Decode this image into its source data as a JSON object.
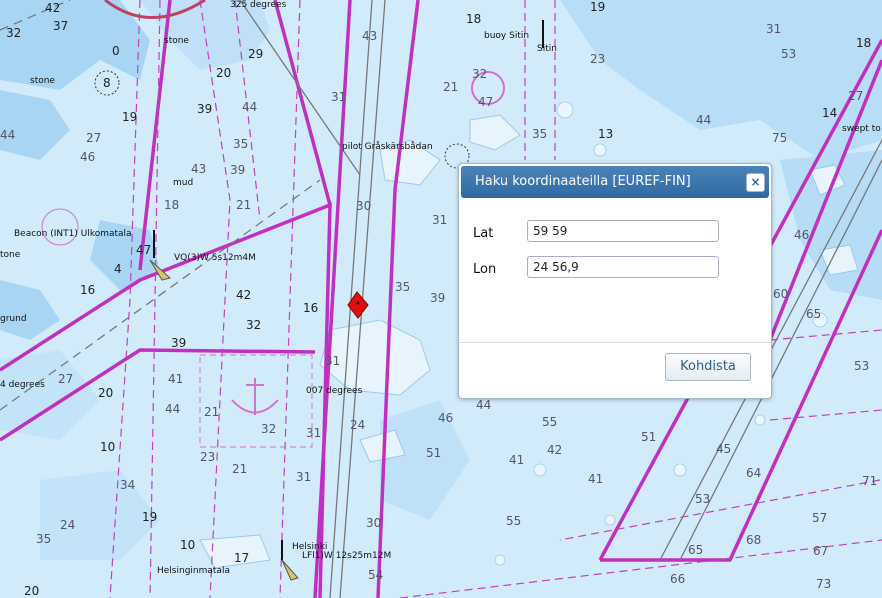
{
  "dialog": {
    "title": "Haku koordinaateilla [EUREF-FIN]",
    "close_label": "×",
    "lat_label": "Lat",
    "lat_value": "59 59",
    "lon_label": "Lon",
    "lon_value": "24 56,9",
    "submit_label": "Kohdista"
  },
  "map": {
    "labels": {
      "bearing_325": "325 degrees",
      "bearing_007": "007 degrees",
      "bearing_left": "4 degrees",
      "stone_top": "stone",
      "stone_left": "stone",
      "stone_far_left": "tone",
      "mud": "mud",
      "pilot": "pilot Gråskärsbådan",
      "buoy": "buoy Sitin",
      "buoy_short": "Sitin",
      "beacon": "Beacon (INT1) Ulkomatala",
      "light_ulko": "VQ(3)W 5s12m4M",
      "helsinki": "Helsinki",
      "light_hki": "LFl1)W 12s25m12M",
      "helsinginmatala": "Helsinginmatala",
      "swept": "swept to",
      "grund": "grund"
    },
    "depths": {
      "d01": "42",
      "d02": "37",
      "d03": "32",
      "d04": "0",
      "d05": "8",
      "d06": "20",
      "d07": "29",
      "d08": "39",
      "d09": "19",
      "d10": "44",
      "d11": "27",
      "d12": "44",
      "d13": "35",
      "d14": "46",
      "d15": "43",
      "d16": "39",
      "d17": "21",
      "d18": "8",
      "d19": "47",
      "d20": "4",
      "d21": "0",
      "d22": "18",
      "d23": "6",
      "d24": "42",
      "d25": "16",
      "d26": "7",
      "d27": "32",
      "d28": "2",
      "d29": "17",
      "d30": "6",
      "d31": "39",
      "d32": "27",
      "d33": "9",
      "d34": "20",
      "d35": "41",
      "d36": "44",
      "d37": "21",
      "d38": "5",
      "d39": "32",
      "d40": "10",
      "d41": "9",
      "d42": "23",
      "d43": "3",
      "d44": "21",
      "d45": "8",
      "d46": "34",
      "d47": "24",
      "d48": "1",
      "d49": "19",
      "d50": "1",
      "d51": "35",
      "d52": "10",
      "d53": "6",
      "d54": "17",
      "d55": "9",
      "d56": "20",
      "d57": "31",
      "d58": "24",
      "d59": "31",
      "d60": "30",
      "d61": "8",
      "d62": "54",
      "d63": "43",
      "d64": "31",
      "d65": "30",
      "d66": "35",
      "d67": "31",
      "d68": "39",
      "d69": "46",
      "d70": "18",
      "d71": "21",
      "d72": "6",
      "d73": "32",
      "d74": "47",
      "d75": "35",
      "d76": "13",
      "d77": "23",
      "d78": "5",
      "d79": "31",
      "d80": "53",
      "d81": "14",
      "d82": "2",
      "d83": "27",
      "d84": "9",
      "d85": "75",
      "d86": "44",
      "d87": "46",
      "d88": "60",
      "d89": "65",
      "d90": "62",
      "d91": "53",
      "d92": "64",
      "d93": "71",
      "d94": "57",
      "d95": "67",
      "d96": "73",
      "d97": "66",
      "d98": "65",
      "d99": "68",
      "e01": "53",
      "e02": "45",
      "e03": "51",
      "e04": "55",
      "e05": "41",
      "e06": "44",
      "e07": "51",
      "e08": "55",
      "e09": "41",
      "e10": "19",
      "e11": "31",
      "e12": "53",
      "e13": "18",
      "e14": "42"
    }
  }
}
